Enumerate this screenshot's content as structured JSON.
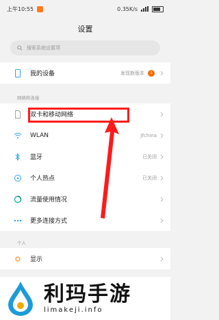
{
  "status": {
    "time": "上午10:55",
    "speed": "0.35K/s"
  },
  "page": {
    "title": "设置"
  },
  "search": {
    "placeholder": "搜索系统设置项"
  },
  "device": {
    "label": "我的设备",
    "value": "发现新版本",
    "badge": "1"
  },
  "network": {
    "header": "网络和连接",
    "items": [
      {
        "label": "双卡和移动网络",
        "value": "",
        "icon": "sim-card-icon"
      },
      {
        "label": "WLAN",
        "value": "Jfchina",
        "icon": "wifi-icon"
      },
      {
        "label": "蓝牙",
        "value": "已关闭",
        "icon": "bluetooth-icon"
      },
      {
        "label": "个人热点",
        "value": "已关闭",
        "icon": "hotspot-icon"
      },
      {
        "label": "流量使用情况",
        "value": "",
        "icon": "data-usage-icon"
      },
      {
        "label": "更多连接方式",
        "value": "",
        "icon": "more-connections-icon"
      }
    ]
  },
  "personal": {
    "header": "个人",
    "items": [
      {
        "label": "显示",
        "icon": "display-icon"
      }
    ]
  },
  "watermark": {
    "title": "利玛手游",
    "url": "limakeji.info"
  },
  "colors": {
    "highlight": "#ff1a1a",
    "badge": "#ff6a00",
    "accent": "#2aa7e0"
  }
}
